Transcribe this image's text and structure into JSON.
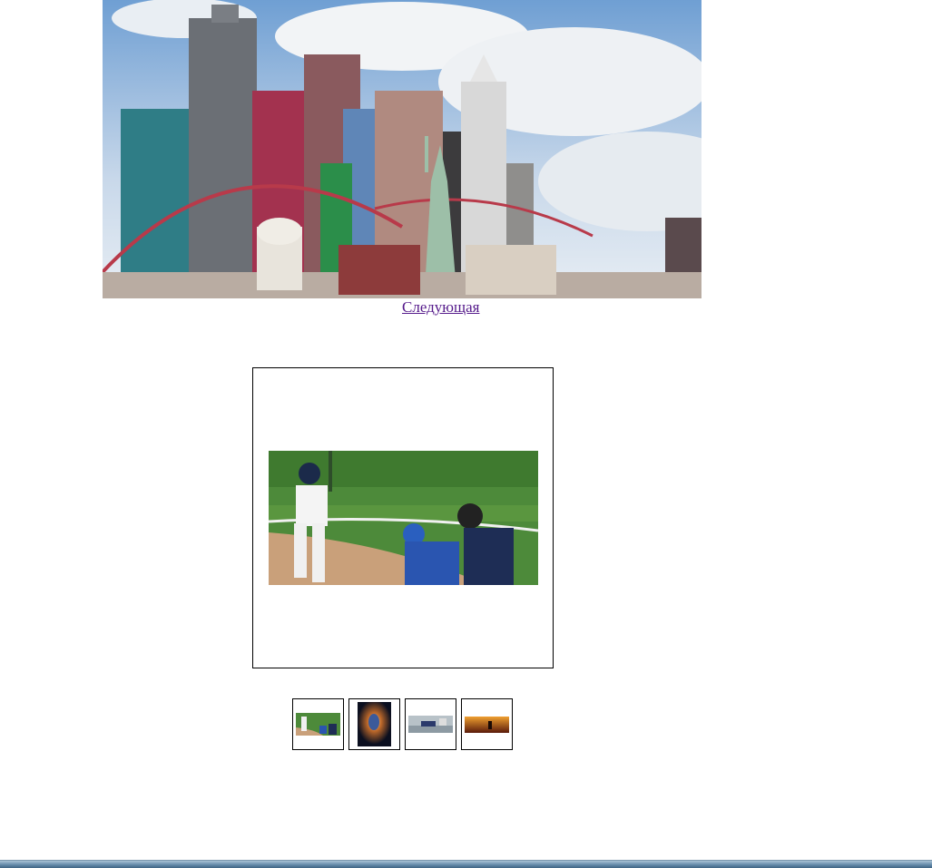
{
  "hero": {
    "icon": "city-skyline-photo"
  },
  "navigation": {
    "next_label": "Следующая"
  },
  "viewer": {
    "icon": "baseball-batter-photo"
  },
  "thumbnails": [
    {
      "icon": "baseball-batter-thumb"
    },
    {
      "icon": "glowing-figure-thumb"
    },
    {
      "icon": "baseball-slide-thumb"
    },
    {
      "icon": "sunset-player-thumb"
    }
  ],
  "colors": {
    "link": "#551a8b",
    "border": "#000000",
    "background": "#ffffff"
  }
}
